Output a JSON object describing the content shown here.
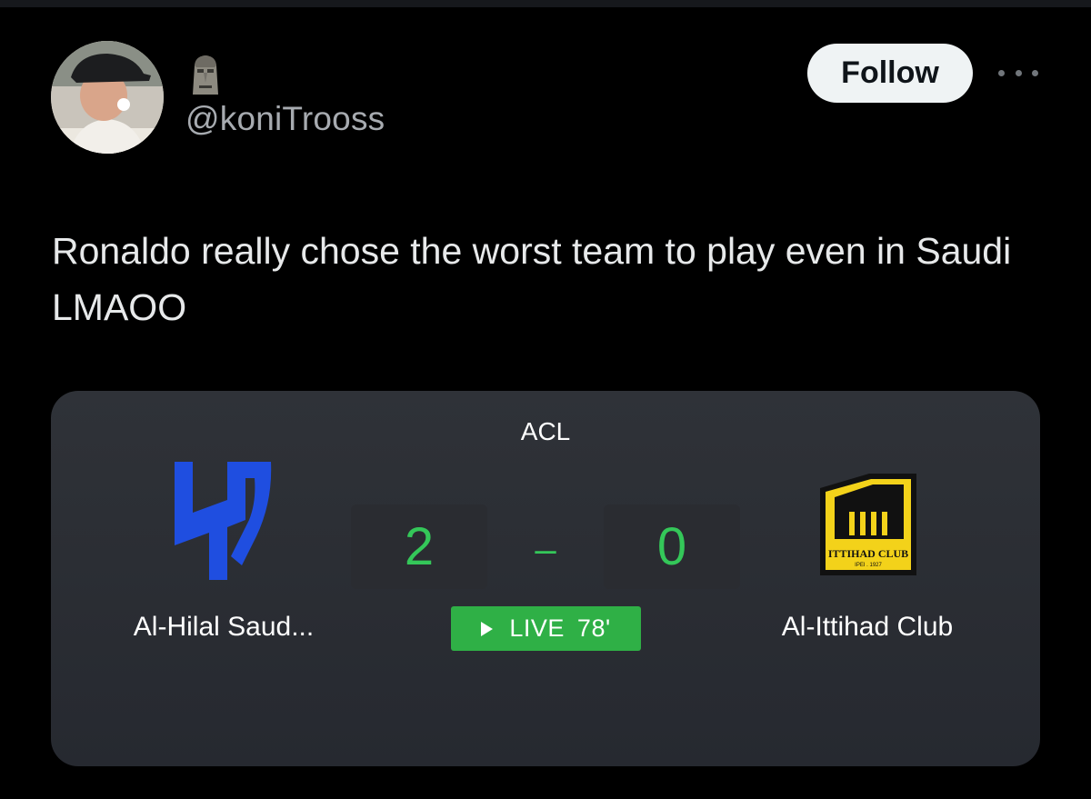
{
  "tweet": {
    "author": {
      "display_name_icon": "moai-emoji-icon",
      "handle": "@koniTrooss"
    },
    "follow_label": "Follow",
    "more_icon": "more-options-icon",
    "text": "Ronaldo really chose the worst team to play even in Saudi LMAOO"
  },
  "match_card": {
    "competition": "ACL",
    "home_team": {
      "name": "Al-Hilal Saud...",
      "logo_icon": "al-hilal-logo-icon",
      "score": "2"
    },
    "separator": "–",
    "away_team": {
      "name": "Al-Ittihad Club",
      "logo_icon": "al-ittihad-logo-icon",
      "score": "0",
      "logo_text": "ITTIHAD CLUB",
      "logo_year": "IPEI . 1927"
    },
    "status": {
      "label": "LIVE",
      "minute": "78'"
    }
  },
  "colors": {
    "background": "#000000",
    "card": "#2d3036",
    "score_green": "#34c759",
    "live_badge": "#2fb046",
    "hilal_blue": "#1f4ee0",
    "ittihad_yellow": "#f3d21a"
  }
}
